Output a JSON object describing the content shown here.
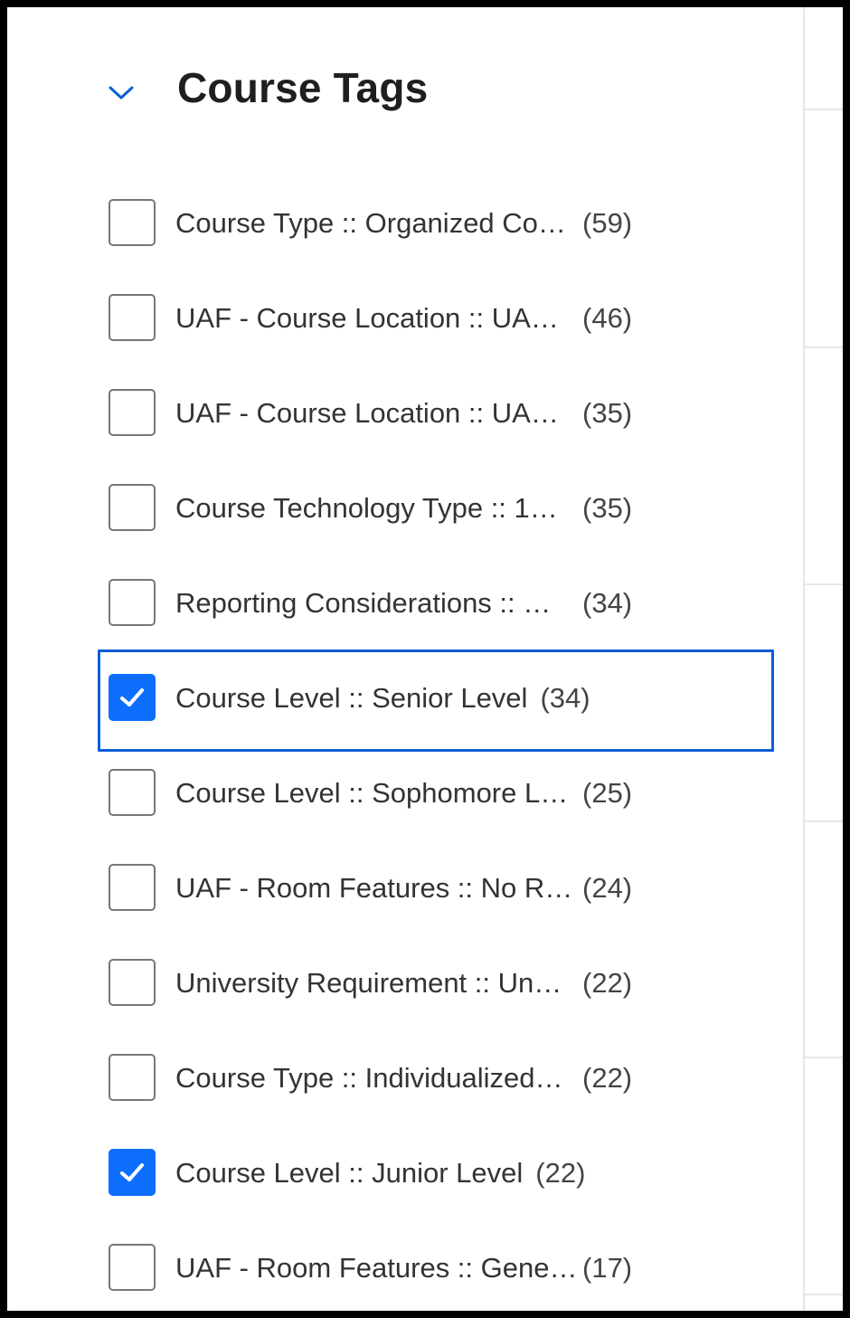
{
  "facet": {
    "title": "Course Tags",
    "expand_icon": "chevron-down-icon",
    "items": [
      {
        "label": "Course Type :: Organized Co…",
        "count": "(59)",
        "checked": false
      },
      {
        "label": "UAF - Course Location :: UA…",
        "count": "(46)",
        "checked": false
      },
      {
        "label": "UAF - Course Location :: UA…",
        "count": "(35)",
        "checked": false
      },
      {
        "label": "Course Technology Type :: 1…",
        "count": "(35)",
        "checked": false
      },
      {
        "label": "Reporting Considerations :: …",
        "count": "(34)",
        "checked": false
      },
      {
        "label": "Course Level :: Senior Level",
        "count": "(34)",
        "checked": true,
        "focused": true
      },
      {
        "label": "Course Level :: Sophomore L…",
        "count": "(25)",
        "checked": false
      },
      {
        "label": "UAF - Room Features :: No R…",
        "count": "(24)",
        "checked": false
      },
      {
        "label": "University Requirement :: Un…",
        "count": "(22)",
        "checked": false
      },
      {
        "label": "Course Type :: Individualized…",
        "count": "(22)",
        "checked": false
      },
      {
        "label": "Course Level :: Junior Level",
        "count": "(22)",
        "checked": true
      },
      {
        "label": "UAF - Room Features :: Gene…",
        "count": "(17)",
        "checked": false
      }
    ]
  },
  "colors": {
    "accent": "#0d6efd",
    "focus_ring": "#0b5cd6",
    "text": "#333333",
    "title": "#1f1f1f"
  }
}
